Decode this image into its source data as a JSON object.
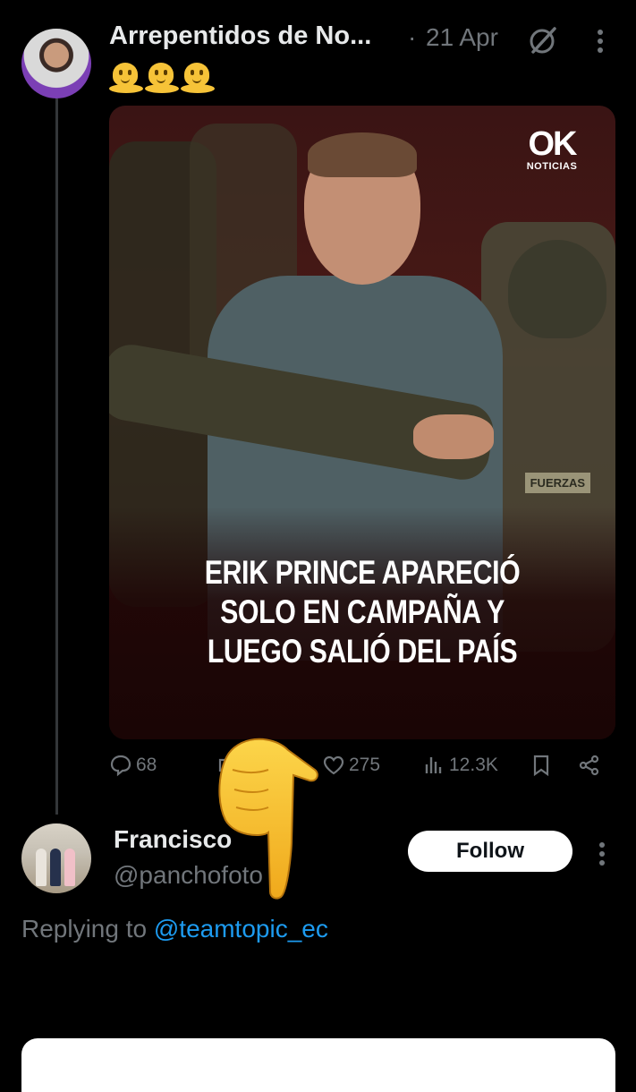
{
  "tweet": {
    "author_name": "Arrepentidos de No...",
    "separator": "·",
    "date": "21 Apr",
    "emoji_text": "🫠🫠🫠",
    "media": {
      "logo_main": "OK",
      "logo_sub": "NOTICIAS",
      "badge_text": "FUERZAS",
      "headline_lines": [
        "ERIK PRINCE APARECIÓ",
        "SOLO EN CAMPAÑA Y",
        "LUEGO SALIÓ DEL PAÍS"
      ]
    },
    "actions": {
      "replies": "68",
      "reposts": "",
      "likes": "275",
      "views": "12.3K"
    }
  },
  "overlay": {
    "emoji": "pointing-hand-emoji"
  },
  "reply": {
    "name": "Francisco",
    "handle": "@panchofoto",
    "follow_label": "Follow",
    "replying_prefix": "Replying to",
    "replying_to": "@teamtopic_ec"
  },
  "icons": {
    "grok": "grok-icon",
    "more": "more-vertical-icon",
    "reply": "reply-icon",
    "repost": "repost-icon",
    "like": "heart-icon",
    "views": "views-icon",
    "bookmark": "bookmark-icon",
    "share": "share-icon"
  },
  "colors": {
    "background": "#000000",
    "text": "#e7e9ea",
    "muted": "#71767b",
    "link": "#1d9bf0",
    "follow_bg": "#ffffff"
  }
}
